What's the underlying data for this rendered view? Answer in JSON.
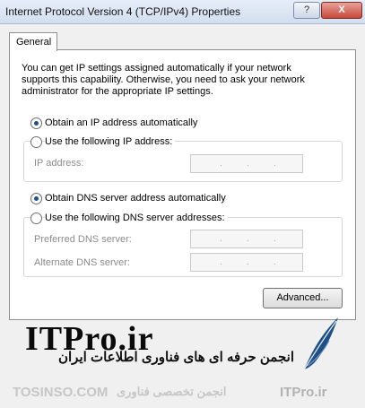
{
  "window": {
    "title": "Internet Protocol Version 4 (TCP/IPv4) Properties",
    "help_label": "?",
    "close_label": "X"
  },
  "tabs": [
    {
      "label": "General"
    }
  ],
  "description": "You can get IP settings assigned automatically if your network supports this capability. Otherwise, you need to ask your network administrator for the appropriate IP settings.",
  "ip": {
    "auto_label": "Obtain an IP address automatically",
    "manual_label": "Use the following IP address:",
    "address_label": "IP address:",
    "selected": "auto"
  },
  "dns": {
    "auto_label": "Obtain DNS server address automatically",
    "manual_label": "Use the following DNS server addresses:",
    "preferred_label": "Preferred DNS server:",
    "alternate_label": "Alternate DNS server:",
    "selected": "auto"
  },
  "advanced_label": "Advanced...",
  "watermark": {
    "logo": "ITPro.ir",
    "persian_text": "انجمن حرفه ای های فناوری اطلاعات ایران",
    "footer_left": "TOSINSO.COM",
    "footer_middle": "انجمن تخصصی فناوری",
    "footer_right": "ITPro.ir"
  },
  "colors": {
    "titlebar": "#d2def0",
    "radio_dot": "#1f4f86",
    "close_button": "#c8483a",
    "feather": "#1f4f86"
  }
}
